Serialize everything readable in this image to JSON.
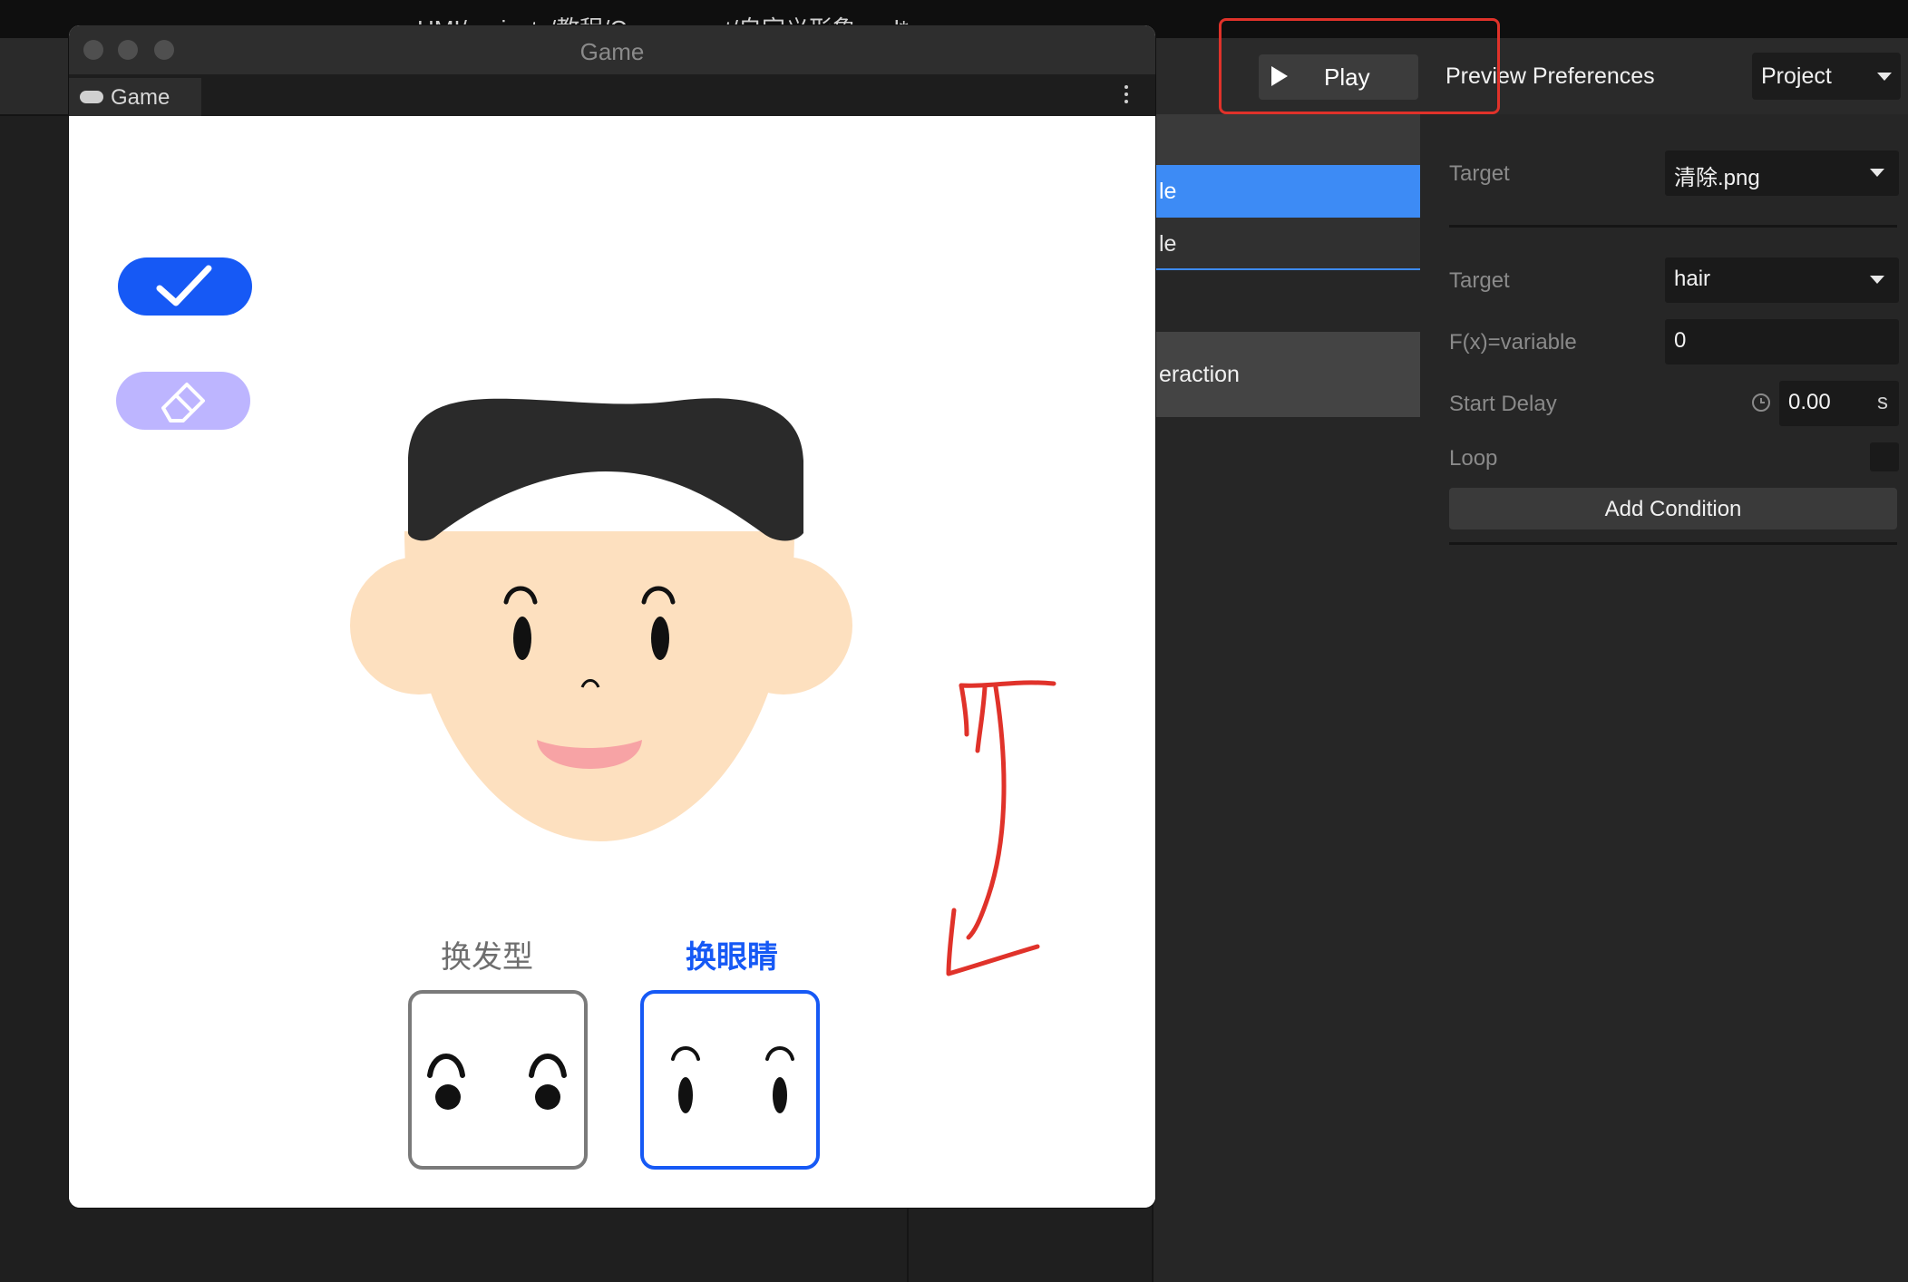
{
  "window": {
    "title": "HMI/projects/教程/Component/自定义形象.xml*"
  },
  "toolbar": {
    "play_label": "Play",
    "preview_preferences_label": "Preview Preferences",
    "project_dropdown_label": "Project"
  },
  "hierarchy": {
    "rows": [
      {
        "label": "le",
        "selected": true
      },
      {
        "label": "le",
        "selected": false
      },
      {
        "label": "eraction",
        "selected": false
      }
    ]
  },
  "inspector": {
    "target1_label": "Target",
    "target1_value": "清除.png",
    "target2_label": "Target",
    "target2_value": "hair",
    "fx_label": "F(x)=variable",
    "fx_value": "0",
    "start_delay_label": "Start Delay",
    "start_delay_value": "0.00",
    "start_delay_unit": "s",
    "loop_label": "Loop",
    "add_condition_label": "Add Condition"
  },
  "game": {
    "window_title": "Game",
    "tab_label": "Game",
    "tabs": [
      {
        "label": "换发型",
        "selected": false
      },
      {
        "label": "换眼睛",
        "selected": true
      }
    ]
  },
  "colors": {
    "accent": "#1659f5",
    "eraser_button": "#bdb5ff",
    "skin": "#fde0bf",
    "hair": "#2a2a2a",
    "mouth": "#f7a3a5",
    "annotation": "#e0322a",
    "selection": "#3d8bf5"
  },
  "icons": [
    "play-icon",
    "gamepad-icon",
    "kebab-icon",
    "checkmark-icon",
    "eraser-icon",
    "clock-icon",
    "dropdown-caret-icon"
  ]
}
